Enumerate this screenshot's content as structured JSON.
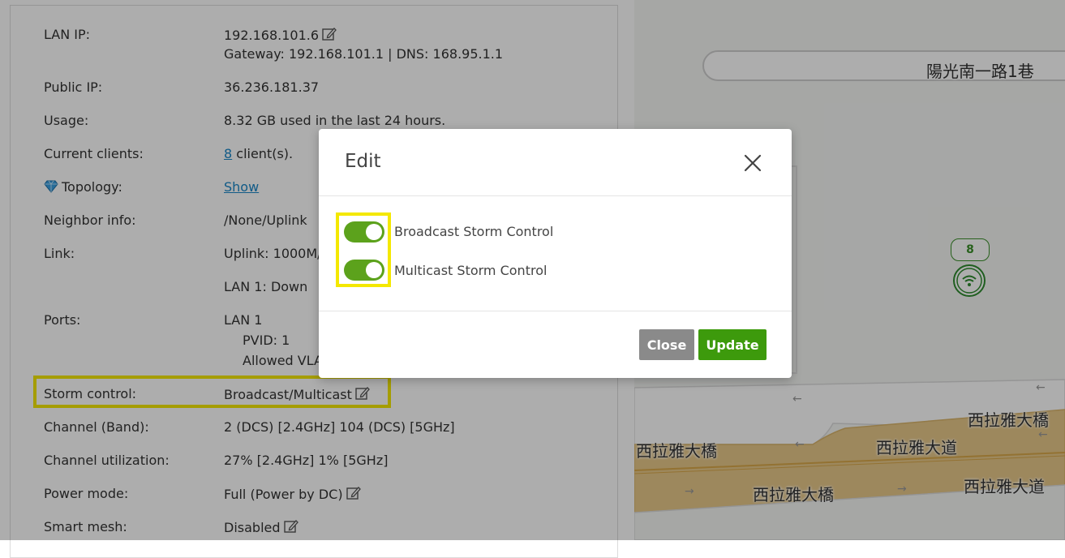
{
  "device_info": {
    "lan_ip": {
      "label": "LAN IP:",
      "value": "192.168.101.6",
      "gateway_line": "Gateway: 192.168.101.1   |   DNS: 168.95.1.1"
    },
    "public_ip": {
      "label": "Public IP:",
      "value": "36.236.181.37"
    },
    "usage": {
      "label": "Usage:",
      "value": "8.32 GB used in the last 24 hours."
    },
    "current_clients": {
      "label": "Current clients:",
      "count": "8",
      "suffix": " client(s)."
    },
    "topology": {
      "label": "Topology:",
      "link": "Show"
    },
    "neighbor_info": {
      "label": "Neighbor info:",
      "value": "/None/Uplink"
    },
    "link": {
      "label": "Link:",
      "value": "Uplink: 1000M/",
      "value2": "LAN 1: Down"
    },
    "ports": {
      "label": "Ports:",
      "value": "LAN 1",
      "pvid": "PVID: 1",
      "allowed": "Allowed VLA"
    },
    "storm_control": {
      "label": "Storm control:",
      "value": "Broadcast/Multicast"
    },
    "channel_band": {
      "label": "Channel (Band):",
      "value": "2 (DCS) [2.4GHz] 104 (DCS) [5GHz]"
    },
    "channel_utilization": {
      "label": "Channel utilization:",
      "value": "27% [2.4GHz] 1% [5GHz]"
    },
    "power_mode": {
      "label": "Power mode:",
      "value": "Full  (Power by DC)"
    },
    "smart_mesh": {
      "label": "Smart mesh:",
      "value": "Disabled"
    }
  },
  "map": {
    "labels": {
      "lane": "陽光南一路1巷",
      "bridge_left": "西拉雅大橋",
      "avenue_mid": "西拉雅大道",
      "bridge_bottom": "西拉雅大橋",
      "avenue_right": "西拉雅大道",
      "bridge_right": "西拉雅大橋"
    },
    "client_badge": "8",
    "colors": {
      "road": "#e8c98a",
      "marker": "#2e8b2e"
    }
  },
  "modal": {
    "title": "Edit",
    "toggles": [
      {
        "label": "Broadcast Storm Control",
        "on": true
      },
      {
        "label": "Multicast Storm Control",
        "on": true
      }
    ],
    "close_label": "Close",
    "update_label": "Update",
    "colors": {
      "toggle_on": "#5ca21c",
      "update": "#3d9a0c",
      "close": "#8a8a8a",
      "highlight": "#f4e800"
    }
  }
}
